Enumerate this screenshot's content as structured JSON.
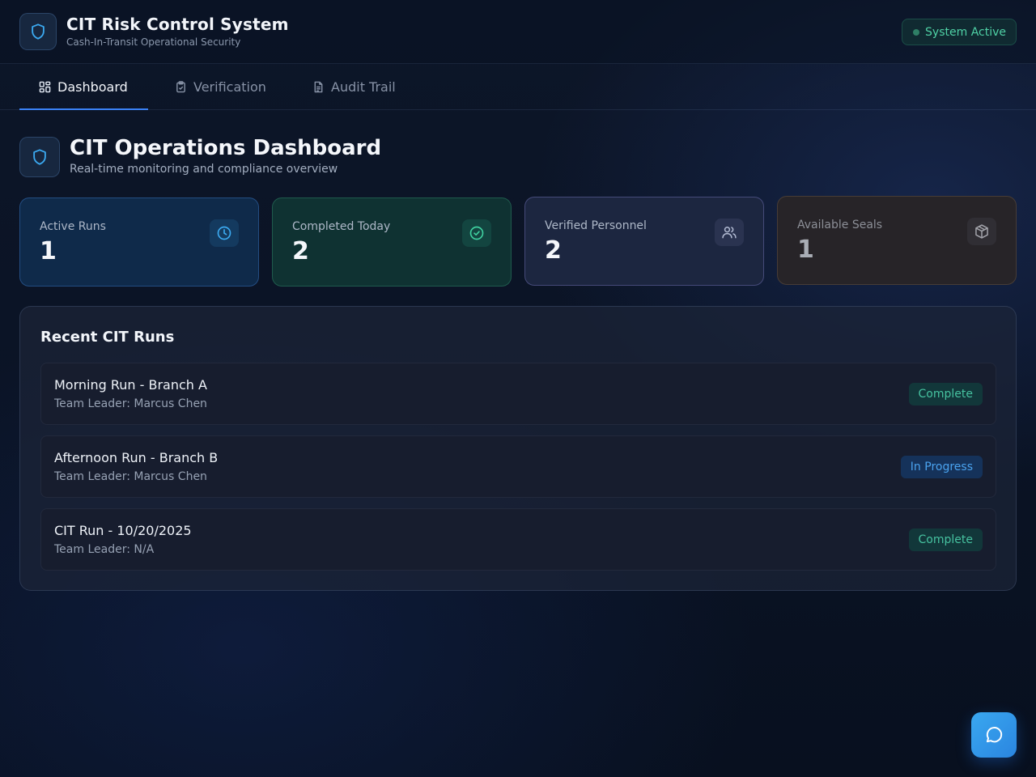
{
  "header": {
    "title": "CIT Risk Control System",
    "subtitle": "Cash-In-Transit Operational Security",
    "status": "System Active"
  },
  "nav": {
    "tabs": [
      {
        "label": "Dashboard",
        "icon": "grid-icon",
        "active": true
      },
      {
        "label": "Verification",
        "icon": "clipboard-check-icon",
        "active": false
      },
      {
        "label": "Audit Trail",
        "icon": "document-icon",
        "active": false
      }
    ]
  },
  "page": {
    "title": "CIT Operations Dashboard",
    "subtitle": "Real-time monitoring and compliance overview"
  },
  "stats": [
    {
      "label": "Active Runs",
      "value": "1",
      "icon": "clock-icon",
      "color": "#3ba9f0"
    },
    {
      "label": "Completed Today",
      "value": "2",
      "icon": "check-circle-icon",
      "color": "#3fcf9f"
    },
    {
      "label": "Verified Personnel",
      "value": "2",
      "icon": "users-icon",
      "color": "#b3bcd4"
    },
    {
      "label": "Available Seals",
      "value": "1",
      "icon": "package-icon",
      "color": "#a3a4ab"
    }
  ],
  "recent_runs": {
    "title": "Recent CIT Runs",
    "items": [
      {
        "name": "Morning Run - Branch A",
        "leader": "Team Leader: Marcus Chen",
        "status": "Complete"
      },
      {
        "name": "Afternoon Run - Branch B",
        "leader": "Team Leader: Marcus Chen",
        "status": "In Progress"
      },
      {
        "name": "CIT Run - 10/20/2025",
        "leader": "Team Leader: N/A",
        "status": "Complete"
      }
    ]
  },
  "colors": {
    "accent": "#3b82f6",
    "complete": "#46c2a0",
    "in_progress": "#4aa3ef",
    "brand_icon": "#3ba9f0"
  }
}
